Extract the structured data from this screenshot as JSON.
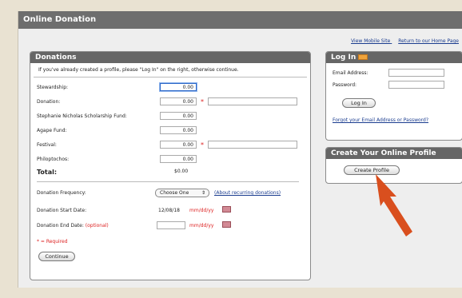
{
  "header": {
    "title": "Online Donation"
  },
  "top_links": [
    "View Mobile Site",
    "Return to our Home Page"
  ],
  "donations": {
    "title": "Donations",
    "intro": "If you've already created a profile, please \"Log In\" on the right, otherwise continue.",
    "funds": [
      {
        "label": "Stewardship:",
        "value": "0.00"
      },
      {
        "label": "Donation:",
        "value": "0.00"
      },
      {
        "label": "Stephanie Nicholas Scholarship Fund:",
        "value": "0.00"
      },
      {
        "label": "Agape Fund:",
        "value": "0.00"
      },
      {
        "label": "Festival:",
        "value": "0.00"
      },
      {
        "label": "Philoptochos:",
        "value": "0.00"
      }
    ],
    "required_marker": "*",
    "total_label": "Total:",
    "total_value": "$0.00",
    "frequency_label": "Donation Frequency:",
    "frequency_selected": "Choose One",
    "frequency_link": "(About recurring donations)",
    "start_label": "Donation Start Date:",
    "start_value": "12/08/18",
    "date_format": "mm/dd/yy",
    "end_label": "Donation End Date:",
    "end_optional": "(optional)",
    "required_note": "* = Required",
    "continue_button": "Continue"
  },
  "login": {
    "title": "Log In",
    "email_label": "Email Address:",
    "password_label": "Password:",
    "login_button": "Log In",
    "forgot_link": "Forgot your Email Address or Password?"
  },
  "create_profile": {
    "title": "Create Your Online Profile",
    "button": "Create Profile"
  },
  "colors": {
    "arrow": "#d94f1e",
    "header": "#6e6e6e",
    "required": "#dd2222"
  }
}
